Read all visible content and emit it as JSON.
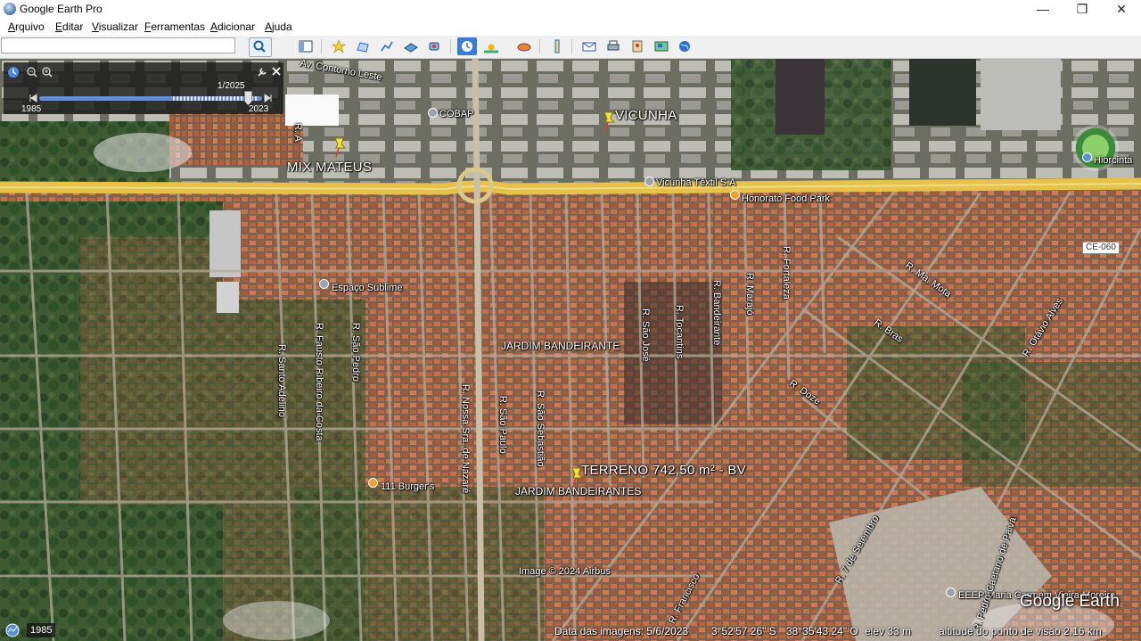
{
  "window": {
    "title": "Google Earth Pro",
    "minimize": "—",
    "restore": "❐",
    "close": "✕"
  },
  "menu": [
    {
      "label": "Arquivo",
      "key": "A",
      "rest": "rquivo"
    },
    {
      "label": "Editar",
      "key": "E",
      "rest": "ditar"
    },
    {
      "label": "Visualizar",
      "key": "V",
      "rest": "isualizar"
    },
    {
      "label": "Ferramentas",
      "key": "F",
      "rest": "erramentas"
    },
    {
      "label": "Adicionar",
      "key": "A",
      "rest": "dicionar"
    },
    {
      "label": "Ajuda",
      "key": "A",
      "rest": "juda"
    }
  ],
  "search": {
    "value": "",
    "placeholder": ""
  },
  "toolbar_icons": [
    "sidebar-toggle-icon",
    "add-placemark-icon",
    "add-polygon-icon",
    "add-path-icon",
    "add-image-overlay-icon",
    "record-tour-icon",
    "historical-imagery-icon",
    "sunlight-icon",
    "planets-icon",
    "ruler-icon",
    "email-icon",
    "print-icon",
    "save-image-icon",
    "view-in-maps-icon",
    "earth-view-icon"
  ],
  "time_slider": {
    "current": "1/2025",
    "start": "1985",
    "end": "2023"
  },
  "map": {
    "places": {
      "mix_mateus": "MIX MATEUS",
      "vicunha": "VICUNHA",
      "terreno": "TERRENO 742,50 m² - BV",
      "jardim_bandeirantes_upper": "JARDIM BANDEIRANTE",
      "jardim_bandeirantes_lower": "JARDIM BANDEIRANTES"
    },
    "pois": {
      "cobap": "COBAP",
      "vicunha_textil": "Vicunha Têxtil S.A",
      "honorato": "Honorato Food Park",
      "hiorcinta": "Hiorcinta",
      "espaco_sublime": "Espaço Sublime",
      "burgers": "111 Burger's",
      "eeep": "EEEP Maria Carmem Vieira Moreira"
    },
    "streets": {
      "contorno_leste": "Av. Contorno Leste",
      "ra": "R. A",
      "ce060": "CE-060",
      "sao_jose": "R. São José",
      "tocantins": "R. Tocantins",
      "bandeirante": "R. Bandeirante",
      "marajo": "R. Marajó",
      "fortaleza": "R. Fortaleza",
      "sao_pedro": "R. São Pedro",
      "fausto": "R. Fausto Ribeiro da Costa",
      "santo_adelino": "R. Santo Adelino",
      "nossa_senhora": "R. Nossa Sra. de Nazaré",
      "sao_paulo": "R. São Paulo",
      "sao_sebastiao": "R. São Sebastião",
      "maria_mota": "R. Ma. Mota",
      "bras": "R. Bras",
      "doze": "R. Doze",
      "otavio_alves": "R. Otávio Alves",
      "sete_setembro": "R. 7 de Setembro",
      "pedro_caetano": "R. Pedro Caetano de Paiva",
      "francisco": "R. Francisco"
    },
    "copyright": "Image © 2024 Airbus",
    "logo": "Google Earth"
  },
  "status": {
    "year": "1985",
    "image_date": "Data das imagens: 5/6/2023",
    "lat": "3°52'57.26\" S",
    "lon": "38°35'43.24\" O",
    "elev": "elev   33 m",
    "eye_alt": "altitude do ponto de visão   2.16 km"
  },
  "colors": {
    "highway": "#e6c24a",
    "roofs": "#c8704a",
    "vegetation": "#2f5a2a",
    "accent": "#3a7bd5"
  }
}
